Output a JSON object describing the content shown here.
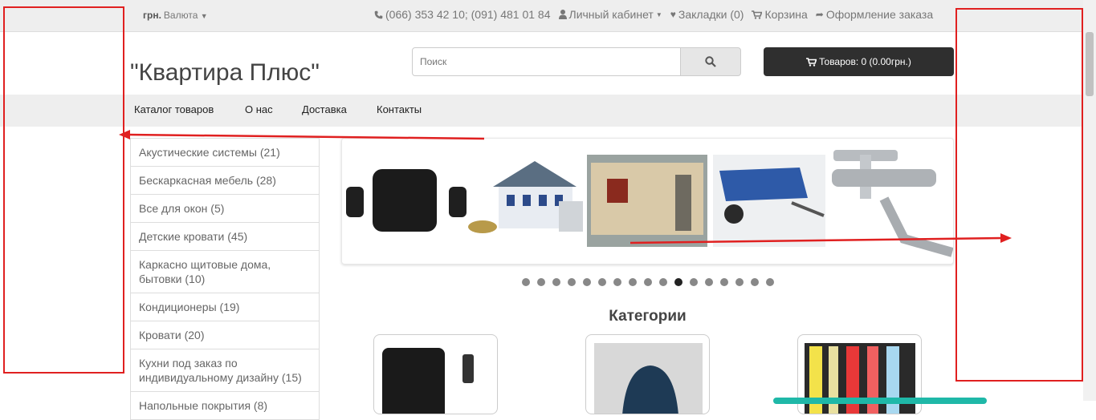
{
  "topbar": {
    "currency_label": "грн.",
    "currency_dropdown": "Валюта",
    "phone": "(066) 353 42 10; (091) 481 01 84",
    "account": "Личный кабинет",
    "bookmarks": "Закладки (0)",
    "cart": "Корзина",
    "checkout": "Оформление заказа"
  },
  "header": {
    "logo": "\"Квартира Плюс\"",
    "search_placeholder": "Поиск",
    "cart_button": "Товаров: 0 (0.00грн.)"
  },
  "menu": {
    "items": [
      "Каталог товаров",
      "О нас",
      "Доставка",
      "Контакты"
    ]
  },
  "sidebar": {
    "categories": [
      "Акустические системы (21)",
      "Бескаркасная мебель (28)",
      "Все для окон (5)",
      "Детские кровати (45)",
      "Каркасно щитовые дома, бытовки (10)",
      "Кондиционеры (19)",
      "Кровати (20)",
      "Кухни под заказ по индивидуальному дизайну (15)",
      "Напольные покрытия (8)"
    ]
  },
  "slider": {
    "dot_count": 17,
    "active_index": 10
  },
  "main": {
    "categories_title": "Категории"
  },
  "colors": {
    "topbar_bg": "#eeeeee",
    "cart_bg": "#2f2f2f",
    "annotation_red": "#e02020"
  },
  "icons": [
    "phone-icon",
    "user-icon",
    "heart-icon",
    "shopping-cart-icon",
    "share-icon",
    "search-icon",
    "caret-down-icon"
  ]
}
